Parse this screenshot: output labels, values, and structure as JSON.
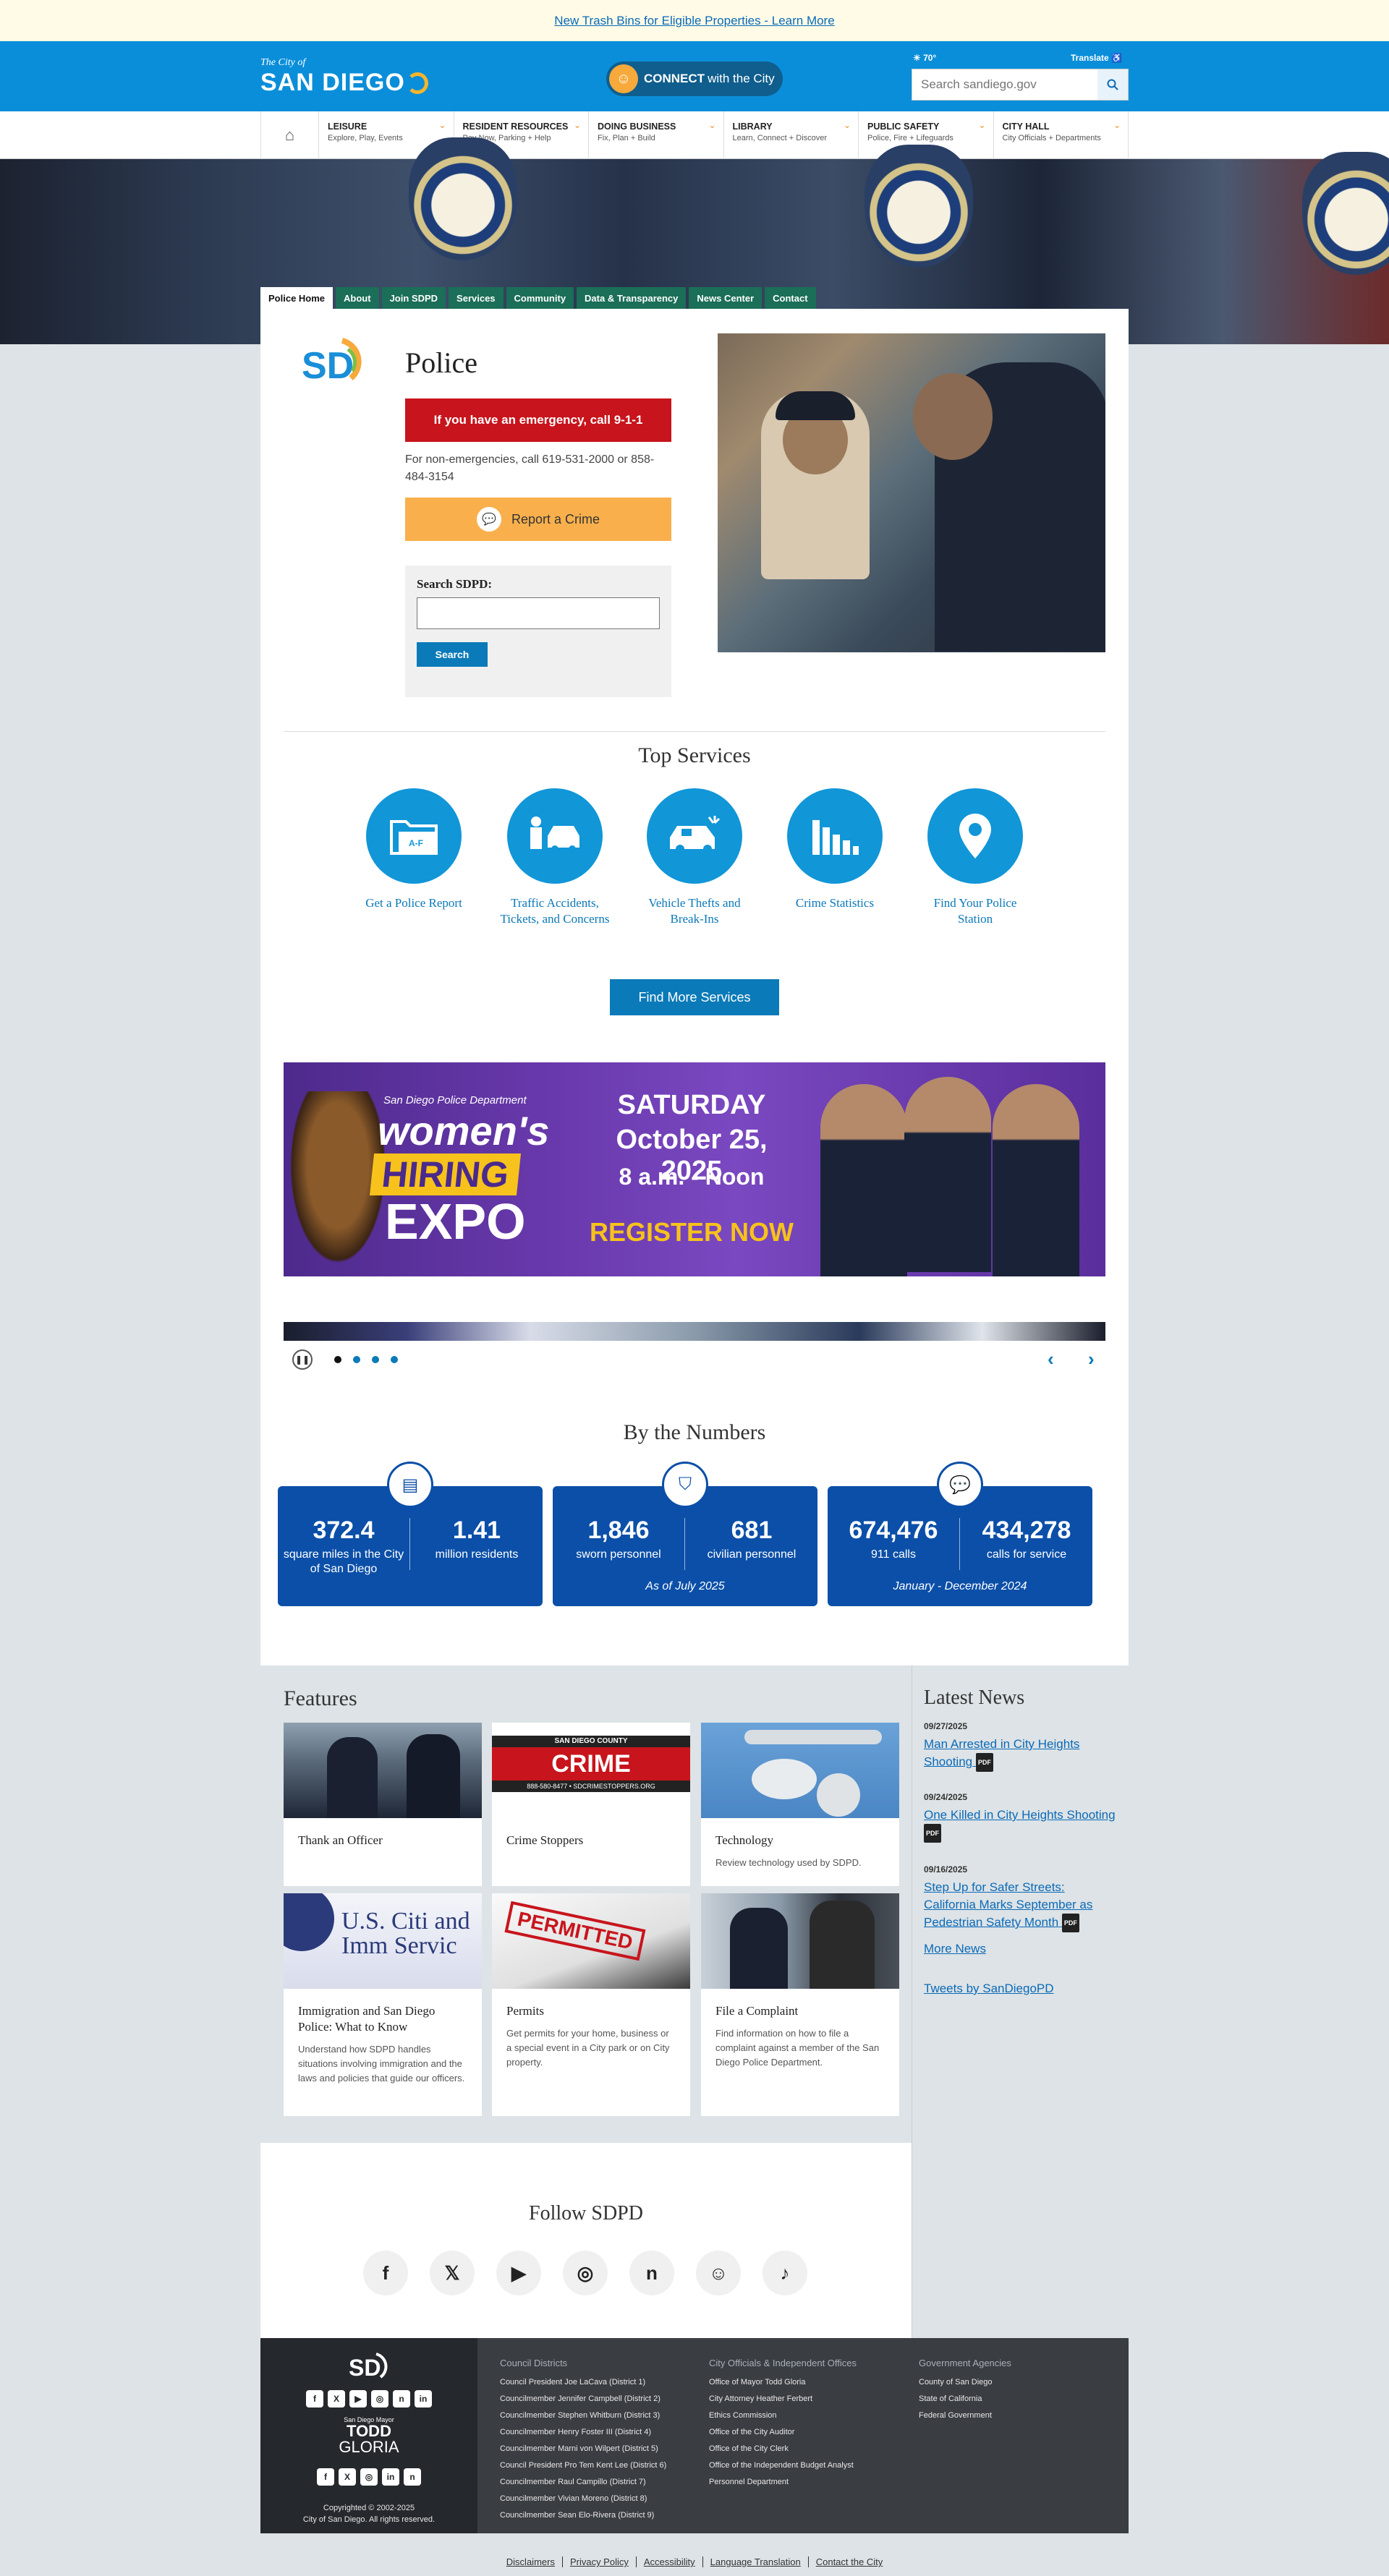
{
  "alert": {
    "link": "New Trash Bins for Eligible Properties - Learn More"
  },
  "header": {
    "logo_small": "The City of",
    "logo_big": "SAN DIEGO",
    "connect_bold": "CONNECT",
    "connect_rest": "with the City",
    "weather": "70°",
    "translate": "Translate",
    "search_placeholder": "Search sandiego.gov"
  },
  "nav": {
    "items": [
      {
        "title": "LEISURE",
        "sub": "Explore, Play, Events"
      },
      {
        "title": "RESIDENT RESOURCES",
        "sub": "Pay Now, Parking + Help"
      },
      {
        "title": "DOING BUSINESS",
        "sub": "Fix, Plan + Build"
      },
      {
        "title": "LIBRARY",
        "sub": "Learn, Connect + Discover"
      },
      {
        "title": "PUBLIC SAFETY",
        "sub": "Police, Fire + Lifeguards"
      },
      {
        "title": "CITY HALL",
        "sub": "City Officials + Departments"
      }
    ]
  },
  "tabs": [
    "Police Home",
    "About",
    "Join SDPD",
    "Services",
    "Community",
    "Data & Transparency",
    "News Center",
    "Contact"
  ],
  "police": {
    "title": "Police",
    "emergency": "If you have an emergency, call 9-1-1",
    "nonemergency": "For non-emergencies, call 619-531-2000 or 858-484-3154",
    "report": "Report a Crime",
    "search_label": "Search SDPD:",
    "search_button": "Search"
  },
  "services": {
    "title": "Top Services",
    "items": [
      {
        "label": "Get a Police Report",
        "icon": "folder-icon"
      },
      {
        "label": "Traffic Accidents, Tickets, and Concerns",
        "icon": "car-officer-icon"
      },
      {
        "label": "Vehicle Thefts and Break-Ins",
        "icon": "car-break-in-icon"
      },
      {
        "label": "Crime Statistics",
        "icon": "bar-chart-icon"
      },
      {
        "label": "Find Your Police Station",
        "icon": "location-badge-icon"
      }
    ],
    "more": "Find More Services"
  },
  "banner": {
    "dept": "San Diego Police Department",
    "w1": "women's",
    "w2": "HIRING",
    "w3": "EXPO",
    "day": "SATURDAY",
    "date": "October 25, 2025",
    "time": "8 a.m. - Noon",
    "cta": "REGISTER NOW"
  },
  "numbers": {
    "title": "By the Numbers",
    "cards": [
      {
        "icon": "document-icon",
        "a_num": "372.4",
        "a_lab": "square miles in the City of San Diego",
        "b_num": "1.41",
        "b_lab": "million residents",
        "note": ""
      },
      {
        "icon": "shield-icon",
        "a_num": "1,846",
        "a_lab": "sworn personnel",
        "b_num": "681",
        "b_lab": "civilian personnel",
        "note": "As of July 2025"
      },
      {
        "icon": "chat-icon",
        "a_num": "674,476",
        "a_lab": "911 calls",
        "b_num": "434,278",
        "b_lab": "calls for service",
        "note": "January - December 2024"
      }
    ]
  },
  "features": {
    "title": "Features",
    "cards": [
      {
        "title": "Thank an Officer",
        "desc": ""
      },
      {
        "title": "Crime Stoppers",
        "desc": ""
      },
      {
        "title": "Technology",
        "desc": "Review technology used by SDPD."
      },
      {
        "title": "Immigration and San Diego Police: What to Know",
        "desc": "Understand how SDPD handles situations involving immigration and the laws and policies that guide our officers."
      },
      {
        "title": "Permits",
        "desc": "Get permits for your home, business or a special event in a City park or on City property."
      },
      {
        "title": "File a Complaint",
        "desc": "Find information on how to file a complaint against a member of the San Diego Police Department."
      }
    ],
    "cs_top": "SAN DIEGO COUNTY",
    "cs_main": "CRIME STOPPERS",
    "cs_sub": "888-580-8477 • SDCRIMESTOPPERS.ORG",
    "imm_text": "U.S. Citi and Imm Servic",
    "permit_text": "PERMITTED"
  },
  "news": {
    "title": "Latest News",
    "items": [
      {
        "date": "09/27/2025",
        "text": "Man Arrested in City Heights Shooting"
      },
      {
        "date": "09/24/2025",
        "text": "One Killed in City Heights Shooting"
      },
      {
        "date": "09/16/2025",
        "text": "Step Up for Safer Streets: California Marks September as Pedestrian Safety Month"
      }
    ],
    "pdf": "PDF",
    "more": "More News",
    "tweets": "Tweets by SanDiegoPD"
  },
  "follow": {
    "title": "Follow SDPD",
    "icons": [
      "facebook-icon",
      "x-icon",
      "youtube-icon",
      "instagram-icon",
      "nextdoor-icon",
      "reddit-icon",
      "tiktok-icon"
    ],
    "glyphs": [
      "f",
      "𝕏",
      "▶",
      "◎",
      "n",
      "☺",
      "♪"
    ]
  },
  "footer": {
    "mayor_small": "San Diego Mayor",
    "mayor_1": "TODD",
    "mayor_2": "GLORIA",
    "copyright1": "Copyrighted © 2002-2025",
    "copyright2": "City of San Diego. All rights reserved.",
    "col1_title": "Council Districts",
    "col1": [
      "Council President Joe LaCava (District 1)",
      "Councilmember Jennifer Campbell (District 2)",
      "Councilmember Stephen Whitburn (District 3)",
      "Councilmember Henry Foster III (District 4)",
      "Councilmember Marni von Wilpert (District 5)",
      "Council President Pro Tem Kent Lee (District 6)",
      "Councilmember Raul Campillo (District 7)",
      "Councilmember Vivian Moreno (District 8)",
      "Councilmember Sean Elo-Rivera (District 9)"
    ],
    "col2_title": "City Officials & Independent Offices",
    "col2": [
      "Office of Mayor Todd Gloria",
      "City Attorney Heather Ferbert",
      "Ethics Commission",
      "Office of the City Auditor",
      "Office of the City Clerk",
      "Office of the Independent Budget Analyst",
      "Personnel Department"
    ],
    "col3_title": "Government Agencies",
    "col3": [
      "County of San Diego",
      "State of California",
      "Federal Government"
    ]
  },
  "bottom_links": [
    "Disclaimers",
    "Privacy Policy",
    "Accessibility",
    "Language Translation",
    "Contact the City"
  ]
}
